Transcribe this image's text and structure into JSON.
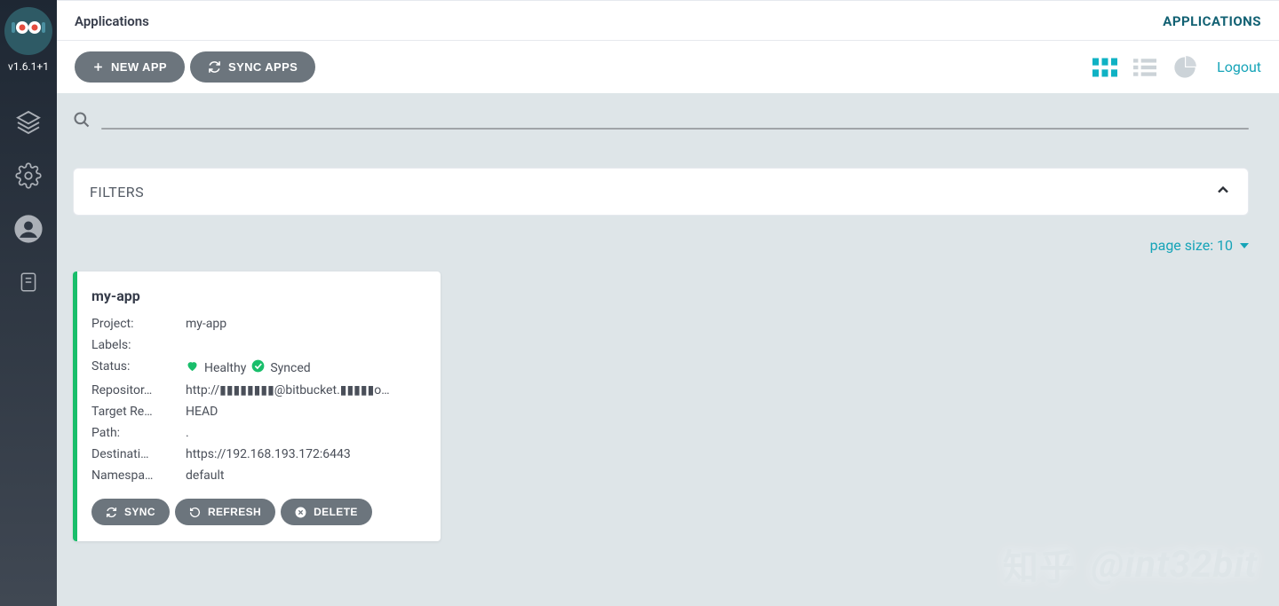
{
  "sidebar": {
    "version": "v1.6.1+1",
    "items": [
      {
        "name": "applications",
        "icon": "layers"
      },
      {
        "name": "settings",
        "icon": "gear"
      },
      {
        "name": "user",
        "icon": "user-circle"
      },
      {
        "name": "docs",
        "icon": "book"
      }
    ]
  },
  "header": {
    "title": "Applications",
    "breadcrumb": "APPLICATIONS"
  },
  "toolbar": {
    "new_app_label": "NEW APP",
    "sync_apps_label": "SYNC APPS",
    "logout_label": "Logout"
  },
  "filters": {
    "title": "FILTERS"
  },
  "page_size": {
    "label": "page size: ",
    "value": "10"
  },
  "app_card": {
    "title": "my-app",
    "rows": {
      "project_label": "Project:",
      "project_value": "my-app",
      "labels_label": "Labels:",
      "labels_value": "",
      "status_label": "Status:",
      "status_health": "Healthy",
      "status_sync": "Synced",
      "repo_label": "Repositor…",
      "repo_value": "http://▮▮▮▮▮▮▮▮@bitbucket.▮▮▮▮▮o…",
      "targetrev_label": "Target Re…",
      "targetrev_value": "HEAD",
      "path_label": "Path:",
      "path_value": ".",
      "dest_label": "Destinati…",
      "dest_value": "https://192.168.193.172:6443",
      "ns_label": "Namespa…",
      "ns_value": "default"
    },
    "actions": {
      "sync": "SYNC",
      "refresh": "REFRESH",
      "delete": "DELETE"
    }
  },
  "watermark": {
    "text": "@int32bit",
    "logo": "知乎"
  }
}
